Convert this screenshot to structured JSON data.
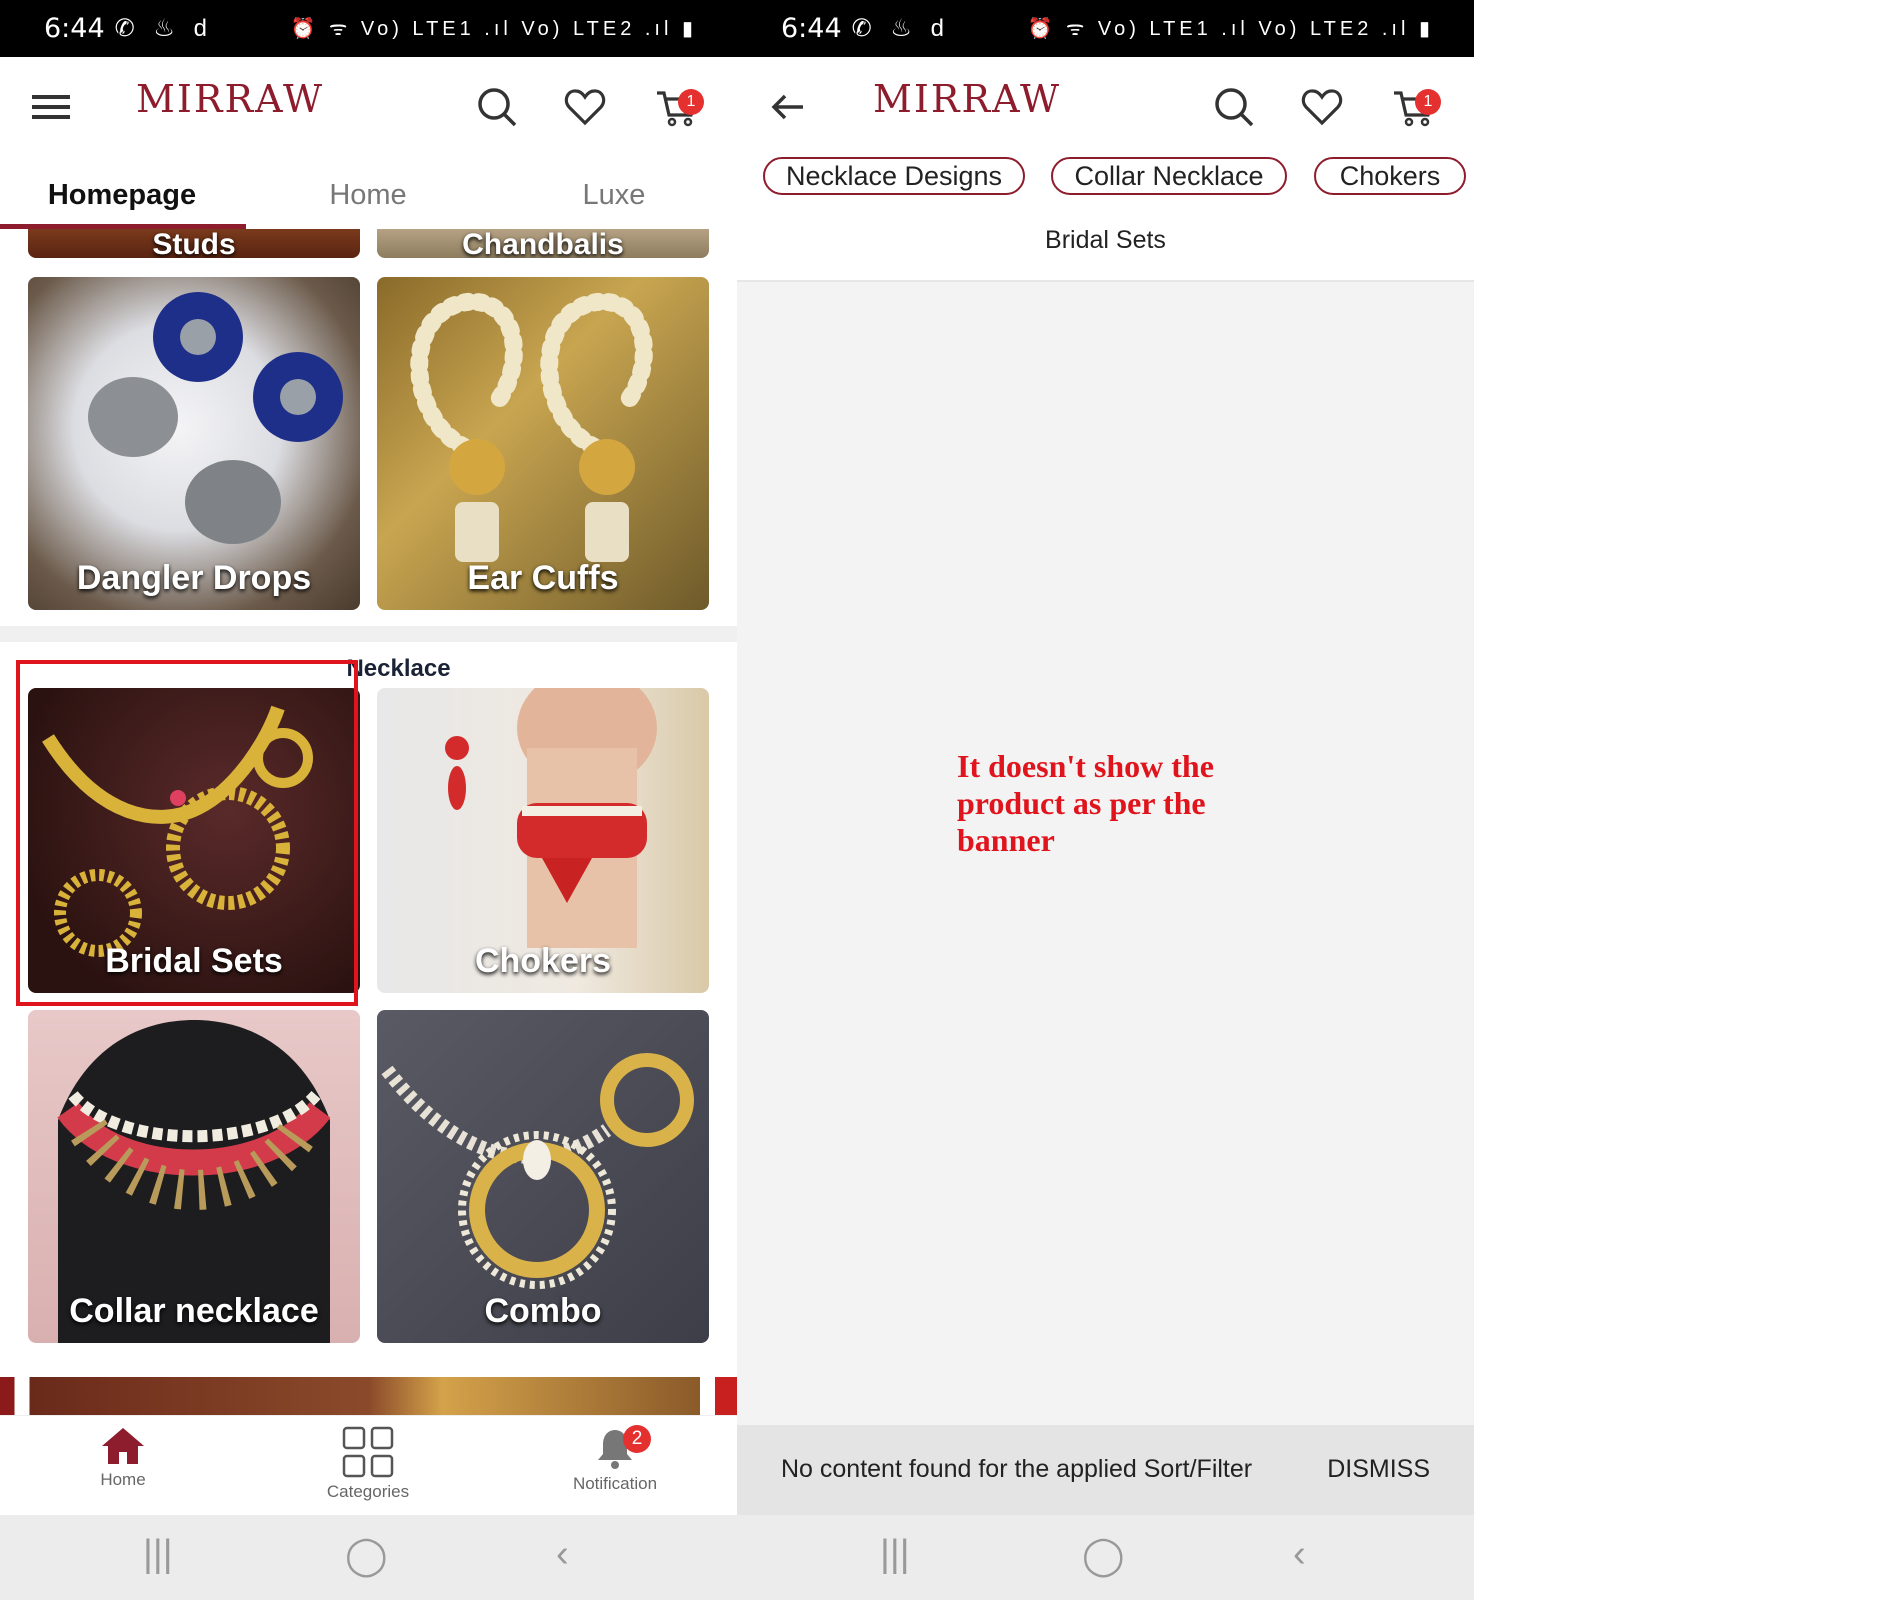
{
  "status_bar": {
    "time": "6:44",
    "left_icons": "✆ ♨ d",
    "right_icons": "⏰ ᯤ Vo) LTE1 .ıl Vo) LTE2 .ıl ▮"
  },
  "app": {
    "logo": "MIRRAW",
    "cart_count": "1",
    "brand_color": "#8d1d2c"
  },
  "left_screen": {
    "tabs": [
      {
        "label": "Homepage"
      },
      {
        "label": "Home"
      },
      {
        "label": "Luxe"
      }
    ],
    "partial_tiles": [
      {
        "label": "Studs"
      },
      {
        "label": "Chandbalis"
      }
    ],
    "earring_tiles": [
      {
        "label": "Dangler Drops"
      },
      {
        "label": "Ear Cuffs"
      }
    ],
    "section_title": "Necklace",
    "necklace_tiles": [
      {
        "label": "Bridal Sets"
      },
      {
        "label": "Chokers"
      },
      {
        "label": "Collar necklace"
      },
      {
        "label": "Combo"
      }
    ],
    "bottom_nav": [
      {
        "label": "Home"
      },
      {
        "label": "Categories"
      },
      {
        "label": "Notification"
      }
    ],
    "notification_count": "2"
  },
  "right_screen": {
    "chips": [
      {
        "label": "Necklace Designs"
      },
      {
        "label": "Collar Necklace"
      },
      {
        "label": "Chokers"
      }
    ],
    "selected_filter": "Bridal Sets",
    "snackbar_message": "No content found for the applied Sort/Filter",
    "snackbar_action": "DISMISS"
  },
  "annotation": "It doesn't show the product as per the banner",
  "highlight_color": "#e0141d"
}
